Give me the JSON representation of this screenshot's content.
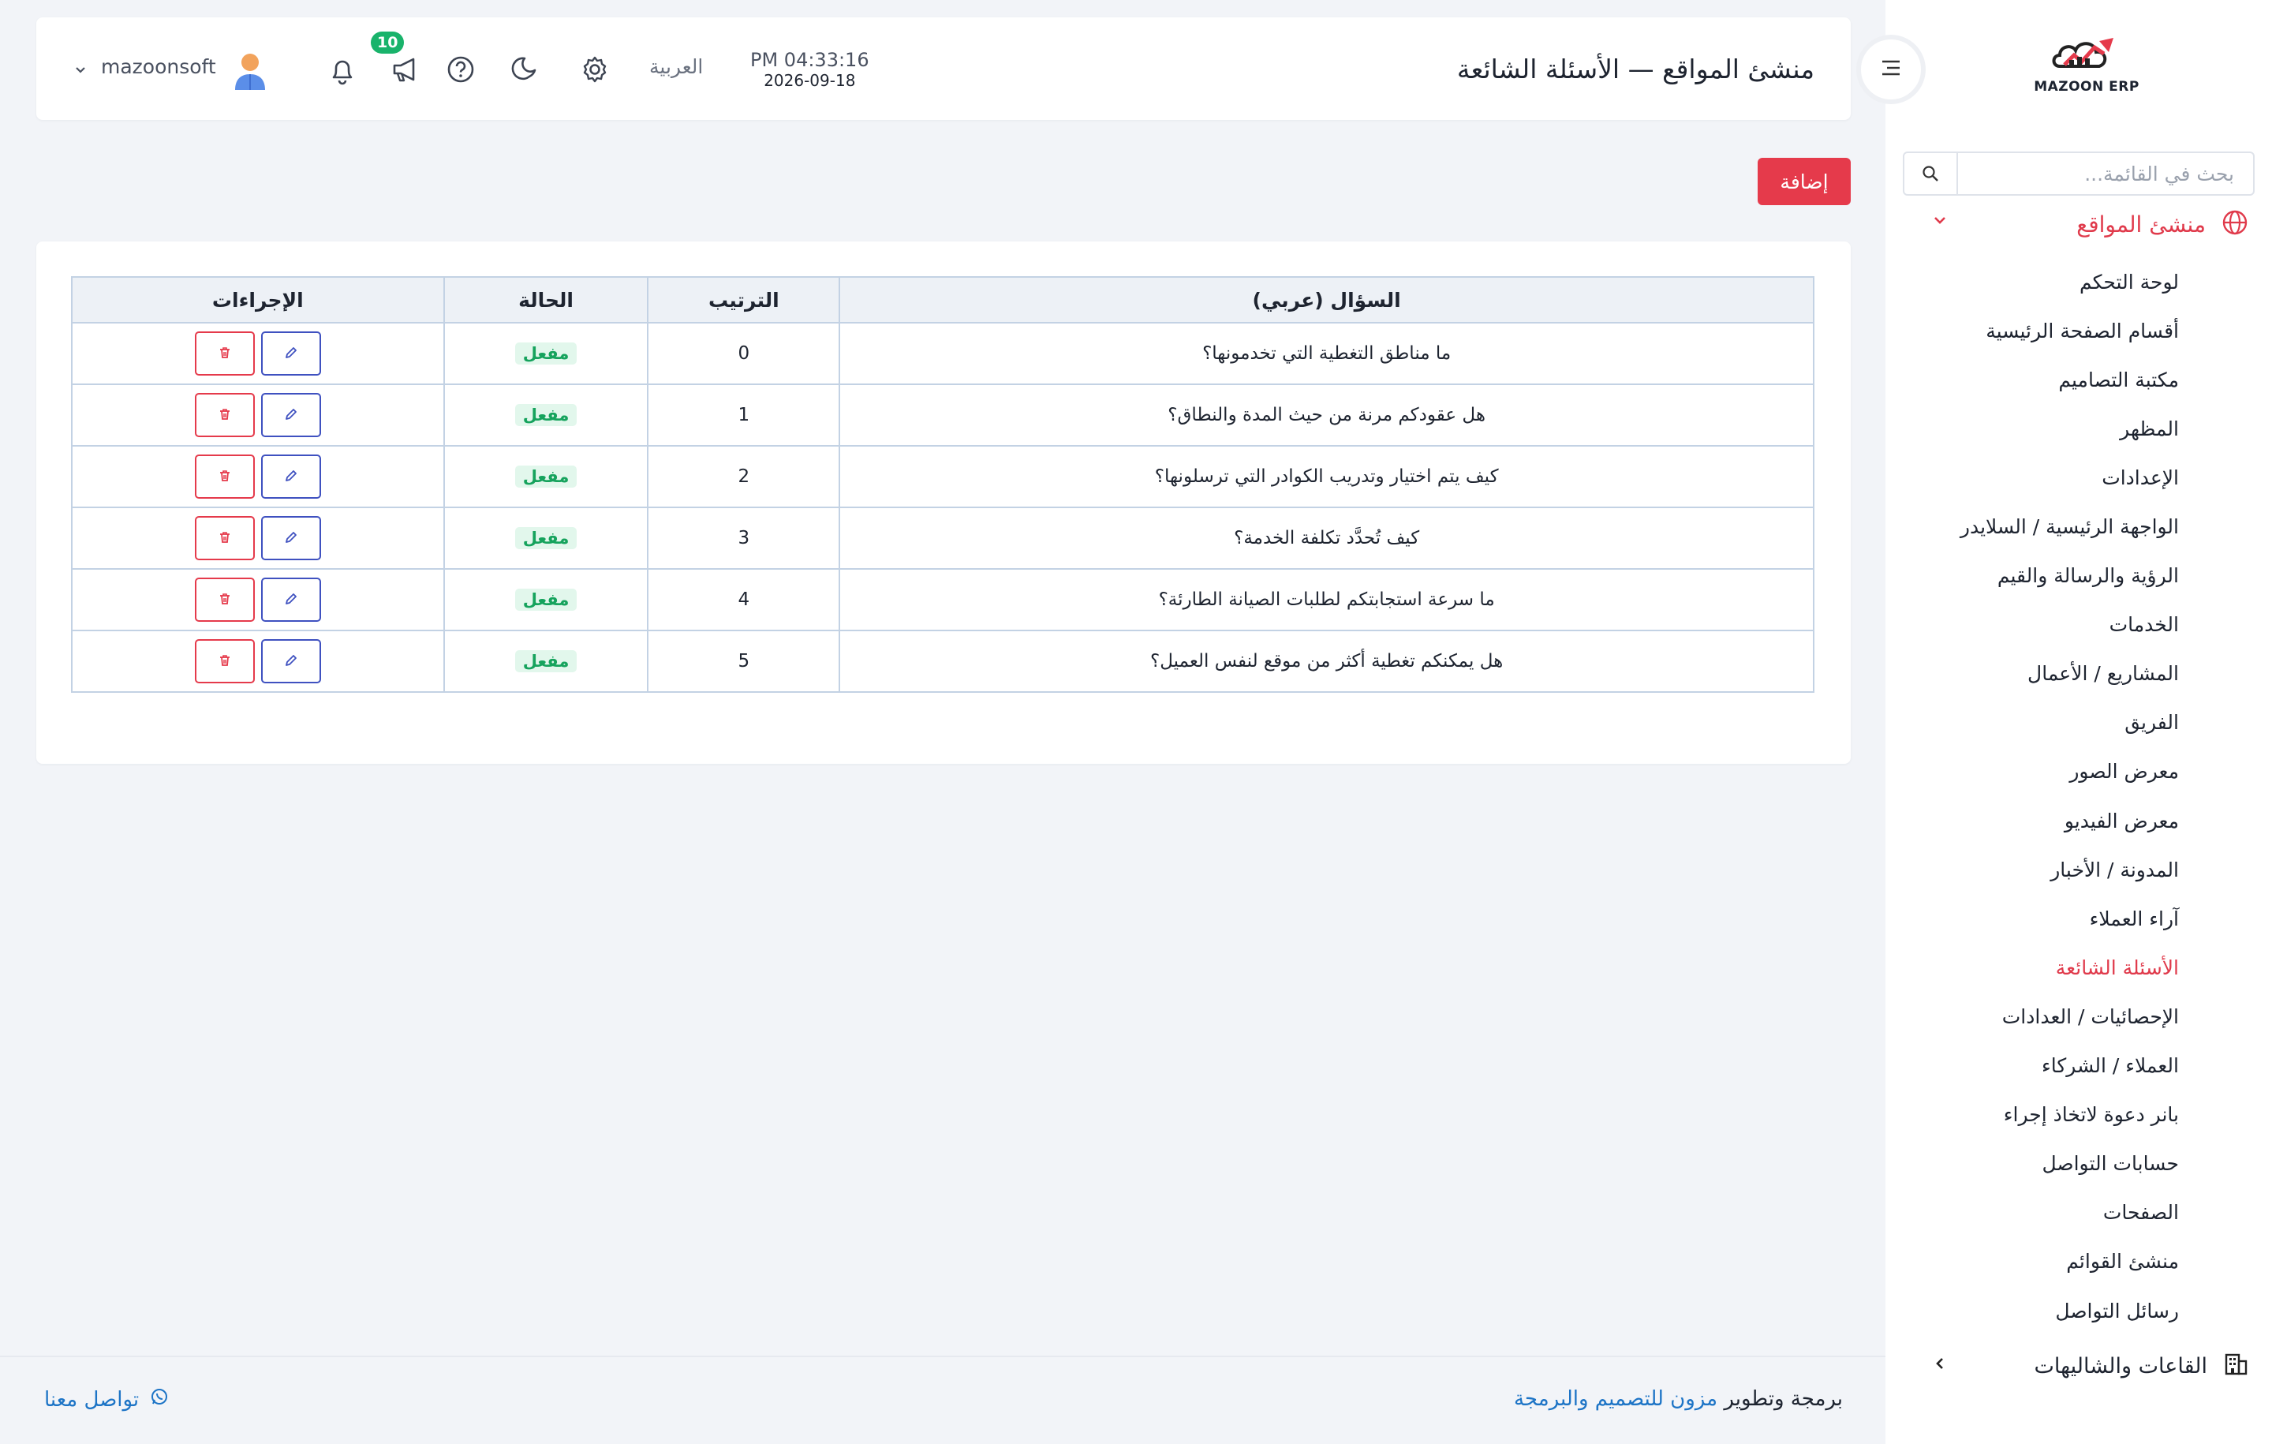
{
  "brand": {
    "logo_text": "MAZOON ERP",
    "logo_small": "ERP.....",
    "accent": "#e53a4b"
  },
  "sidebar": {
    "search_placeholder": "بحث في القائمة...",
    "group_label": "منشئ المواقع",
    "items": [
      {
        "label": "لوحة التحكم"
      },
      {
        "label": "أقسام الصفحة الرئيسية"
      },
      {
        "label": "مكتبة التصاميم"
      },
      {
        "label": "المظهر"
      },
      {
        "label": "الإعدادات"
      },
      {
        "label": "الواجهة الرئيسية / السلايدر"
      },
      {
        "label": "الرؤية والرسالة والقيم"
      },
      {
        "label": "الخدمات"
      },
      {
        "label": "المشاريع / الأعمال"
      },
      {
        "label": "الفريق"
      },
      {
        "label": "معرض الصور"
      },
      {
        "label": "معرض الفيديو"
      },
      {
        "label": "المدونة / الأخبار"
      },
      {
        "label": "آراء العملاء"
      },
      {
        "label": "الأسئلة الشائعة",
        "active": true
      },
      {
        "label": "الإحصائيات / العدادات"
      },
      {
        "label": "العملاء / الشركاء"
      },
      {
        "label": "بانر دعوة لاتخاذ إجراء"
      },
      {
        "label": "حسابات التواصل"
      },
      {
        "label": "الصفحات"
      },
      {
        "label": "منشئ القوائم"
      },
      {
        "label": "رسائل التواصل"
      }
    ],
    "group2_label": "القاعات والشاليهات"
  },
  "header": {
    "title": "منشئ المواقع — الأسئلة الشائعة",
    "time": "PM 04:33:16",
    "date": "2026-09-18",
    "language": "العربية",
    "notification_count": "10",
    "username": "mazoonsoft"
  },
  "toolbar": {
    "add_label": "إضافة"
  },
  "table": {
    "columns": [
      "السؤال (عربي)",
      "الترتيب",
      "الحالة",
      "الإجراءات"
    ],
    "rows": [
      {
        "question": "ما مناطق التغطية التي تخدمونها؟",
        "order": "0",
        "status": "مفعل"
      },
      {
        "question": "هل عقودكم مرنة من حيث المدة والنطاق؟",
        "order": "1",
        "status": "مفعل"
      },
      {
        "question": "كيف يتم اختيار وتدريب الكوادر التي ترسلونها؟",
        "order": "2",
        "status": "مفعل"
      },
      {
        "question": "كيف تُحدَّد تكلفة الخدمة؟",
        "order": "3",
        "status": "مفعل"
      },
      {
        "question": "ما سرعة استجابتكم لطلبات الصيانة الطارئة؟",
        "order": "4",
        "status": "مفعل"
      },
      {
        "question": "هل يمكنكم تغطية أكثر من موقع لنفس العميل؟",
        "order": "5",
        "status": "مفعل"
      }
    ]
  },
  "footer": {
    "credit_prefix": "برمجة وتطوير",
    "credit_link": "مزون للتصميم والبرمجة",
    "contact_label": "تواصل معنا"
  }
}
